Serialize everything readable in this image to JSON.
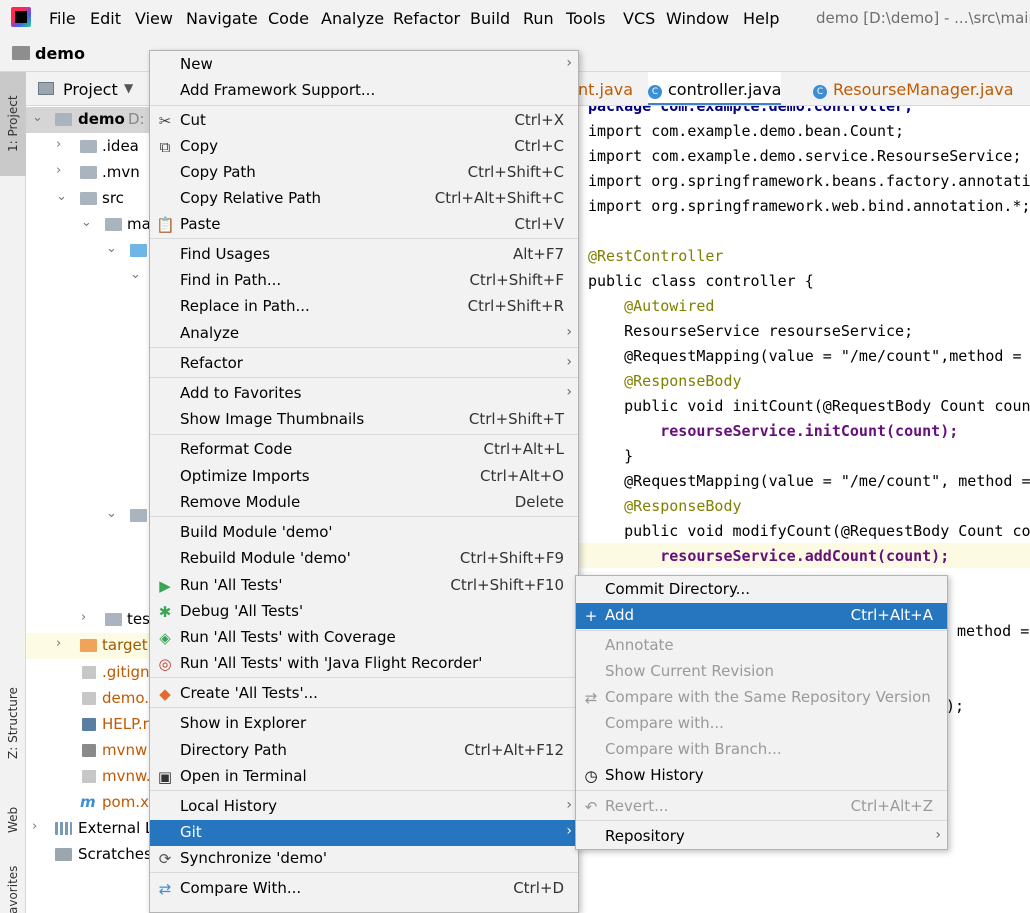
{
  "menubar": {
    "items": [
      "File",
      "Edit",
      "View",
      "Navigate",
      "Code",
      "Analyze",
      "Refactor",
      "Build",
      "Run",
      "Tools",
      "VCS",
      "Window",
      "Help"
    ],
    "window_title": "demo [D:\\demo] - ...\\src\\main"
  },
  "navbar": {
    "title": "demo"
  },
  "toolstrip": {
    "project": "1: Project",
    "structure": "Z: Structure",
    "web": "Web",
    "favorites": "avorites"
  },
  "project_panel": {
    "title": "Project",
    "tree": [
      {
        "label": "demo",
        "suffix": "D:",
        "icon": "module-folder-icon"
      },
      {
        "label": ".idea",
        "icon": "folder-icon"
      },
      {
        "label": ".mvn",
        "icon": "folder-icon"
      },
      {
        "label": "src",
        "icon": "folder-icon"
      },
      {
        "label": "ma",
        "icon": "folder-icon"
      },
      {
        "label": "tes",
        "icon": "folder-icon"
      },
      {
        "label": "target",
        "icon": "folder-icon"
      },
      {
        "label": ".gitign",
        "icon": "file-icon"
      },
      {
        "label": "demo.",
        "icon": "file-icon"
      },
      {
        "label": "HELP.r",
        "icon": "markdown-icon"
      },
      {
        "label": "mvnw",
        "icon": "script-icon"
      },
      {
        "label": "mvnw.",
        "icon": "file-icon"
      },
      {
        "label": "pom.x",
        "icon": "maven-icon"
      },
      {
        "label": "External L",
        "icon": "library-icon"
      },
      {
        "label": "Scratches",
        "icon": "scratches-icon"
      }
    ]
  },
  "editor": {
    "tabs": [
      {
        "label": "nt.java"
      },
      {
        "label": "controller.java"
      },
      {
        "label": "ResourseManager.java"
      }
    ],
    "lines": [
      "package com.example.demo.controller;",
      "import com.example.demo.bean.Count;",
      "import com.example.demo.service.ResourseService;",
      "import org.springframework.beans.factory.annotati",
      "import org.springframework.web.bind.annotation.*;",
      "",
      "@RestController",
      "public class controller {",
      "    @Autowired",
      "    ResourseService resourseService;",
      "    @RequestMapping(value = \"/me/count\",method =",
      "    @ResponseBody",
      "    public void initCount(@RequestBody Count coun",
      "        resourseService.initCount(count);",
      "    }",
      "    @RequestMapping(value = \"/me/count\", method =",
      "    @ResponseBody",
      "    public void modifyCount(@RequestBody Count co",
      "        resourseService.addCount(count);"
    ],
    "fragment_1": "method =",
    "fragment_2": ");"
  },
  "context_menu": {
    "items": [
      {
        "label": "New",
        "shortcut": "",
        "submenu": true,
        "icon": ""
      },
      {
        "label": "Add Framework Support...",
        "shortcut": "",
        "submenu": false,
        "icon": ""
      },
      {
        "label": "Cut",
        "shortcut": "Ctrl+X",
        "submenu": false,
        "icon": "cut-icon"
      },
      {
        "label": "Copy",
        "shortcut": "Ctrl+C",
        "submenu": false,
        "icon": "copy-icon"
      },
      {
        "label": "Copy Path",
        "shortcut": "Ctrl+Shift+C",
        "submenu": false,
        "icon": ""
      },
      {
        "label": "Copy Relative Path",
        "shortcut": "Ctrl+Alt+Shift+C",
        "submenu": false,
        "icon": ""
      },
      {
        "label": "Paste",
        "shortcut": "Ctrl+V",
        "submenu": false,
        "icon": "paste-icon"
      },
      {
        "label": "Find Usages",
        "shortcut": "Alt+F7",
        "submenu": false,
        "icon": ""
      },
      {
        "label": "Find in Path...",
        "shortcut": "Ctrl+Shift+F",
        "submenu": false,
        "icon": ""
      },
      {
        "label": "Replace in Path...",
        "shortcut": "Ctrl+Shift+R",
        "submenu": false,
        "icon": ""
      },
      {
        "label": "Analyze",
        "shortcut": "",
        "submenu": true,
        "icon": ""
      },
      {
        "label": "Refactor",
        "shortcut": "",
        "submenu": true,
        "icon": ""
      },
      {
        "label": "Add to Favorites",
        "shortcut": "",
        "submenu": true,
        "icon": ""
      },
      {
        "label": "Show Image Thumbnails",
        "shortcut": "Ctrl+Shift+T",
        "submenu": false,
        "icon": ""
      },
      {
        "label": "Reformat Code",
        "shortcut": "Ctrl+Alt+L",
        "submenu": false,
        "icon": ""
      },
      {
        "label": "Optimize Imports",
        "shortcut": "Ctrl+Alt+O",
        "submenu": false,
        "icon": ""
      },
      {
        "label": "Remove Module",
        "shortcut": "Delete",
        "submenu": false,
        "icon": ""
      },
      {
        "label": "Build Module 'demo'",
        "shortcut": "",
        "submenu": false,
        "icon": ""
      },
      {
        "label": "Rebuild Module 'demo'",
        "shortcut": "Ctrl+Shift+F9",
        "submenu": false,
        "icon": ""
      },
      {
        "label": "Run 'All Tests'",
        "shortcut": "Ctrl+Shift+F10",
        "submenu": false,
        "icon": "run-icon"
      },
      {
        "label": "Debug 'All Tests'",
        "shortcut": "",
        "submenu": false,
        "icon": "debug-icon"
      },
      {
        "label": "Run 'All Tests' with Coverage",
        "shortcut": "",
        "submenu": false,
        "icon": "coverage-icon"
      },
      {
        "label": "Run 'All Tests' with 'Java Flight Recorder'",
        "shortcut": "",
        "submenu": false,
        "icon": "profiler-icon"
      },
      {
        "label": "Create 'All Tests'...",
        "shortcut": "",
        "submenu": false,
        "icon": "create-test-icon"
      },
      {
        "label": "Show in Explorer",
        "shortcut": "",
        "submenu": false,
        "icon": ""
      },
      {
        "label": "Directory Path",
        "shortcut": "Ctrl+Alt+F12",
        "submenu": false,
        "icon": ""
      },
      {
        "label": "Open in Terminal",
        "shortcut": "",
        "submenu": false,
        "icon": "terminal-icon"
      },
      {
        "label": "Local History",
        "shortcut": "",
        "submenu": true,
        "icon": ""
      },
      {
        "label": "Git",
        "shortcut": "",
        "submenu": true,
        "icon": ""
      },
      {
        "label": "Synchronize 'demo'",
        "shortcut": "",
        "submenu": false,
        "icon": "sync-icon"
      },
      {
        "label": "Compare With...",
        "shortcut": "Ctrl+D",
        "submenu": false,
        "icon": "compare-icon"
      }
    ]
  },
  "git_submenu": {
    "items": [
      {
        "label": "Commit Directory...",
        "shortcut": "",
        "icon": ""
      },
      {
        "label": "Add",
        "shortcut": "Ctrl+Alt+A",
        "icon": "plus-icon"
      },
      {
        "label": "Annotate",
        "shortcut": "",
        "icon": ""
      },
      {
        "label": "Show Current Revision",
        "shortcut": "",
        "icon": ""
      },
      {
        "label": "Compare with the Same Repository Version",
        "shortcut": "",
        "icon": "compare-icon"
      },
      {
        "label": "Compare with...",
        "shortcut": "",
        "icon": ""
      },
      {
        "label": "Compare with Branch...",
        "shortcut": "",
        "icon": ""
      },
      {
        "label": "Show History",
        "shortcut": "",
        "icon": "clock-icon"
      },
      {
        "label": "Revert...",
        "shortcut": "Ctrl+Alt+Z",
        "icon": "revert-icon"
      },
      {
        "label": "Repository",
        "shortcut": "",
        "icon": ""
      }
    ]
  },
  "colors": {
    "accent": "#2675bf",
    "menu_bg": "#f2f2f2",
    "panel_bg": "#ffffff",
    "keyword": "#000080",
    "annotation": "#808000",
    "field": "#660e7a",
    "string": "#008000"
  }
}
